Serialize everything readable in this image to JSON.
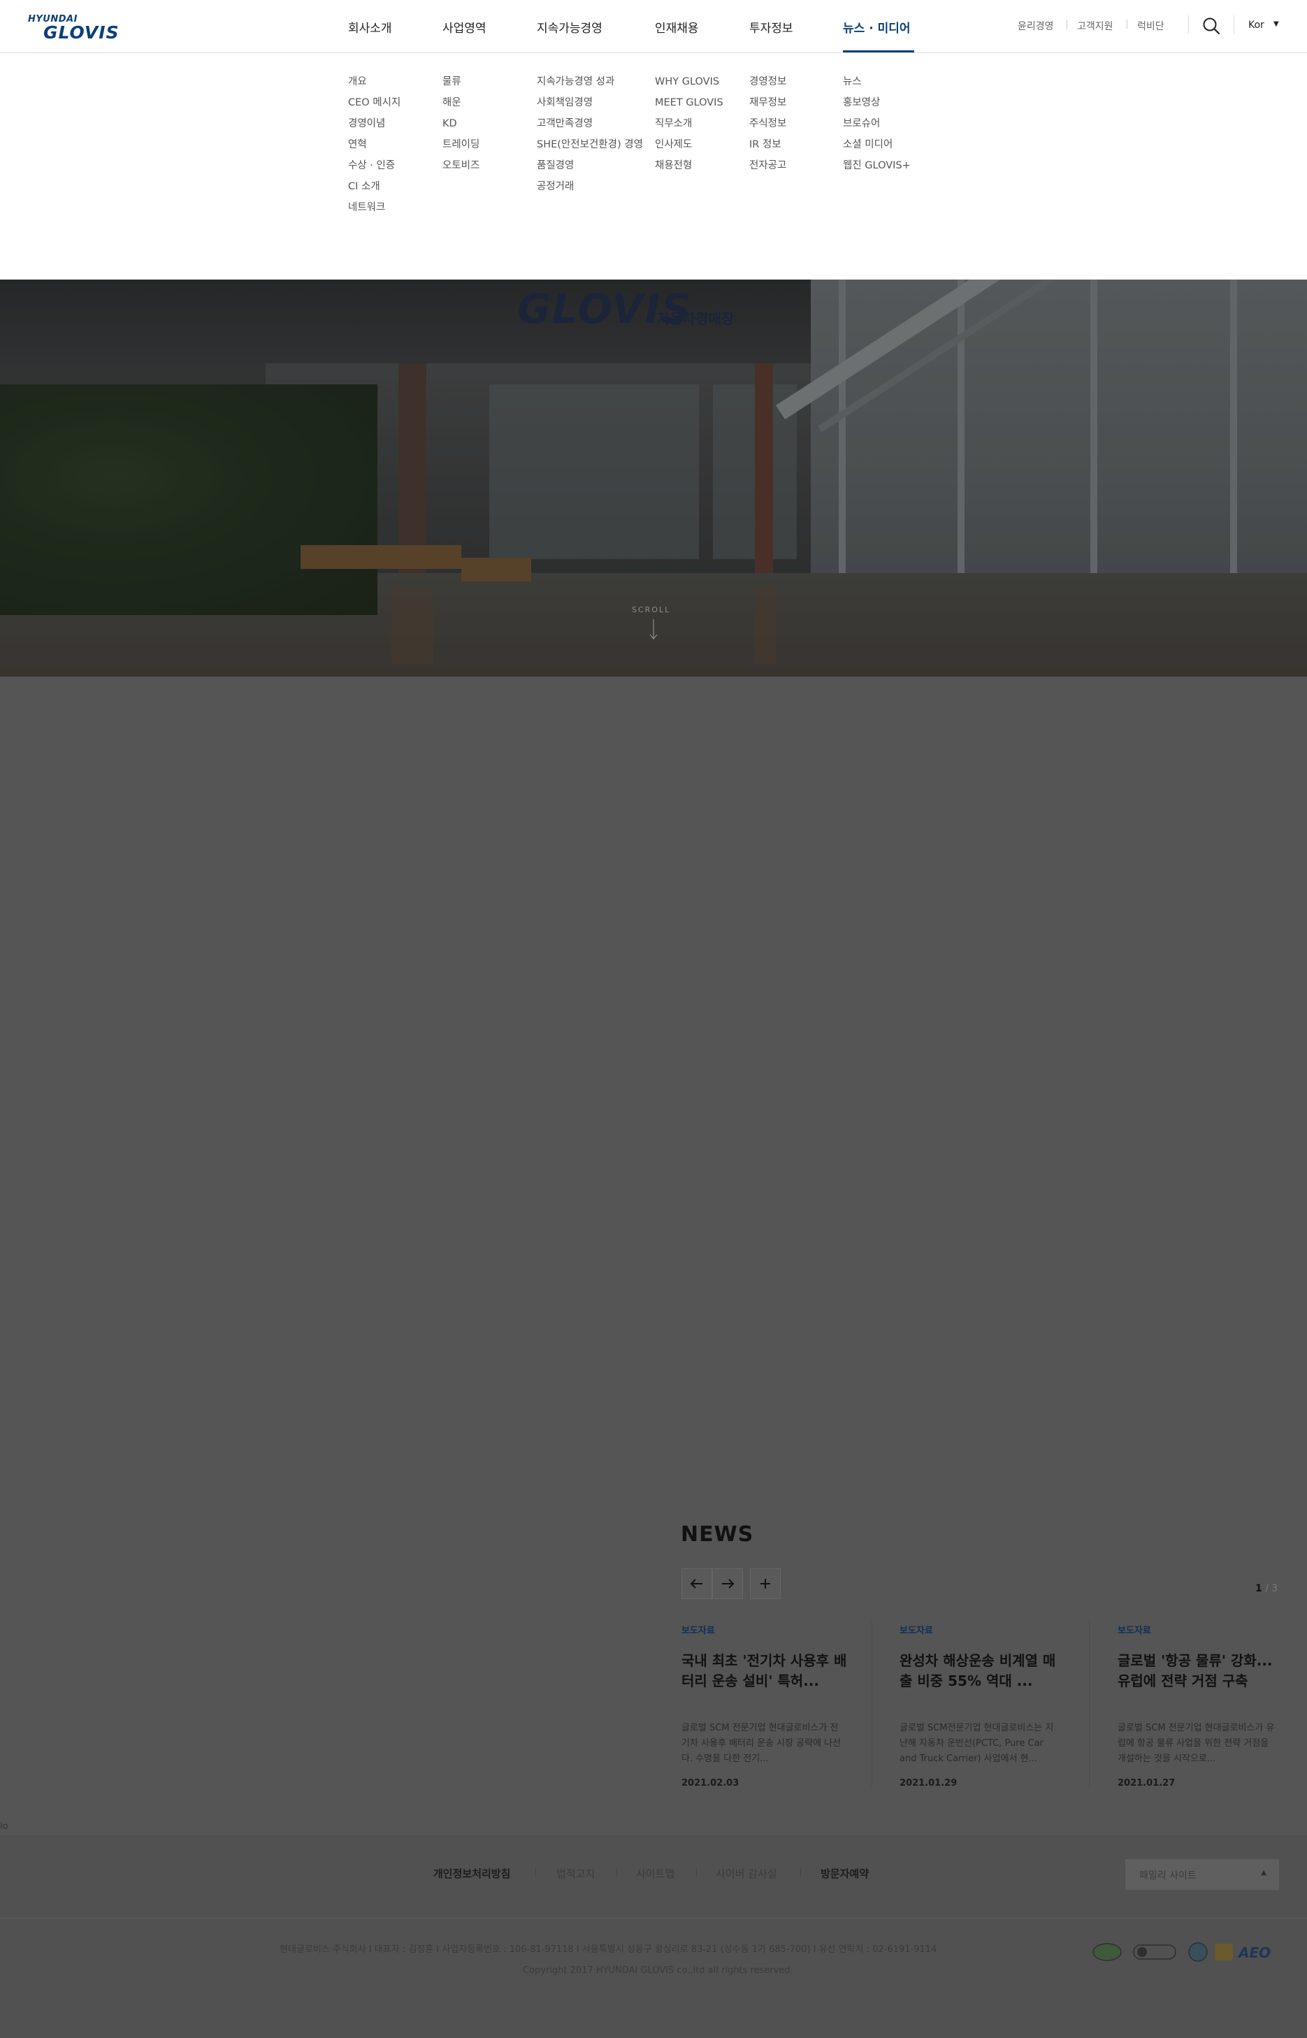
{
  "logo": {
    "line1": "HYUNDAI",
    "line2": "GLOVIS"
  },
  "gnb": [
    {
      "label": "회사소개"
    },
    {
      "label": "사업영역"
    },
    {
      "label": "지속가능경영"
    },
    {
      "label": "인재채용"
    },
    {
      "label": "투자정보"
    },
    {
      "label": "뉴스 · 미디어",
      "active": true
    }
  ],
  "util": {
    "ethics": "윤리경영",
    "support": "고객지원",
    "hub": "럭비단"
  },
  "search": {
    "icon": "search-icon"
  },
  "lang": {
    "label": "Kor",
    "caret": "▼"
  },
  "mega": {
    "company": [
      "개요",
      "CEO 메시지",
      "경영이념",
      "연혁",
      "수상 · 인증",
      "CI 소개",
      "네트워크"
    ],
    "business": [
      "물류",
      "해운",
      "KD",
      "트레이딩",
      "오토비즈"
    ],
    "sustain": [
      "지속가능경영 성과",
      "사회책임경영",
      "고객만족경영",
      "SHE(안전보건환경) 경영",
      "품질경영",
      "공정거래"
    ],
    "recruit": [
      "WHY GLOVIS",
      "MEET GLOVIS",
      "직무소개",
      "인사제도",
      "채용전형"
    ],
    "ir": [
      "경영정보",
      "재무정보",
      "주식정보",
      "IR 정보",
      "전자공고"
    ],
    "media": [
      "뉴스",
      "홍보영상",
      "브로슈어",
      "소셜 미디어",
      "웹진 GLOVIS+"
    ]
  },
  "hero": {
    "scroll": "SCROLL",
    "sign": "GLOVIS",
    "sign_sub": "자동차경매장"
  },
  "news": {
    "title": "NEWS",
    "pager": {
      "current": "1",
      "sep": " / ",
      "total": "3"
    },
    "cards": [
      {
        "category": "보도자료",
        "title": "국내 최초 '전기차 사용후 배터리 운송 설비' 특허...",
        "desc": "글로벌 SCM 전문기업 현대글로비스가 전기차 사용후 배터리 운송 시장 공략에 나선다. 수명을 다한 전기...",
        "date": "2021.02.03"
      },
      {
        "category": "보도자료",
        "title": "완성차 해상운송 비계열 매출 비중 55% 역대 ...",
        "desc": "글로벌 SCM전문기업 현대글로비스는 지난해 자동차 운반선(PCTC, Pure Car and Truck Carrier) 사업에서 현...",
        "date": "2021.01.29"
      },
      {
        "category": "보도자료",
        "title": "글로벌 '항공 물류' 강화... 유럽에 전략 거점 구축",
        "desc": "글로벌 SCM 전문기업 현대글로비스가 유럽에 항공 물류 사업을 위한 전략 거점을 개설하는 것을 시작으로...",
        "date": "2021.01.27"
      }
    ]
  },
  "stray_text": "lo",
  "footer": {
    "links": [
      "개인정보처리방침",
      "법적고지",
      "사이트맵",
      "사이버 감사실",
      "방문자예약"
    ],
    "family": "패밀리 사이트",
    "family_caret": "▲",
    "info": "현대글로비스 주식회사 I 대표자 : 김정훈  I  사업자등록번호 : 106-81-97118  I  서울특별시 성동구 왕십리로 83-21 (성수동 1가 685-700)  I  유선 연락처 : 02-6191-9114",
    "copyright": "Copyright 2017 HYUNDAI GLOVIS co.,ltd all rights reserved.",
    "certs": [
      "cert-badge-1",
      "cert-badge-2",
      "cert-badge-3",
      "cert-badge-4",
      "AEO"
    ]
  },
  "colors": {
    "brand": "#0c3f7a",
    "dim": "#555555"
  }
}
